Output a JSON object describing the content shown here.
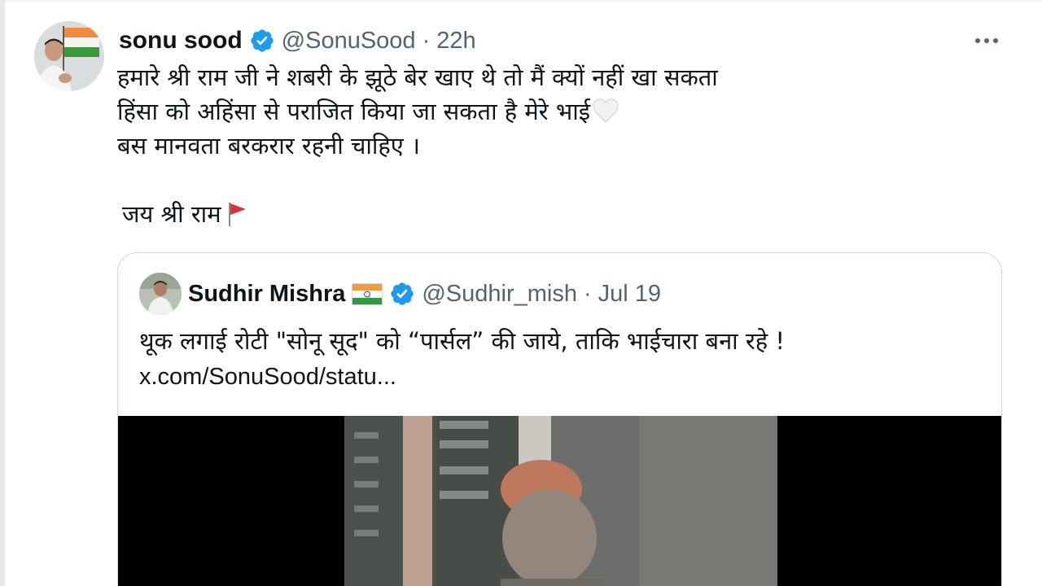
{
  "tweet": {
    "author_name": "sonu sood",
    "author_handle": "@SonuSood",
    "separator": "·",
    "time": "22h",
    "lines": [
      "हमारे श्री राम जी ने शबरी के झूठे बेर खाए थे तो मैं क्यों नहीं खा सकता",
      "हिंसा को अहिंसा से पराजित किया जा सकता है मेरे भाई",
      "बस मानवता बरकरार रहनी चाहिए ।"
    ],
    "sign_off": "जय श्री राम",
    "icons": {
      "verified": "verified-badge-icon",
      "more": "more-options-icon",
      "heart": "white-heart-emoji-icon",
      "flag": "triangular-flag-emoji-icon"
    }
  },
  "quoted_tweet": {
    "author_name": "Sudhir Mishra",
    "author_handle": "@Sudhir_mish",
    "separator": "·",
    "time": "Jul 19",
    "text": "थूक लगाई रोटी \"सोनू सूद\" को “पार्सल” की जाये, ताकि भाईचारा बना रहे !",
    "link": "x.com/SonuSood/statu...",
    "icons": {
      "flag": "india-flag-emoji-icon",
      "verified": "verified-badge-icon"
    }
  },
  "colors": {
    "verified_blue": "#1d9bf0",
    "secondary_text": "#536471",
    "border": "#cfd9de"
  }
}
